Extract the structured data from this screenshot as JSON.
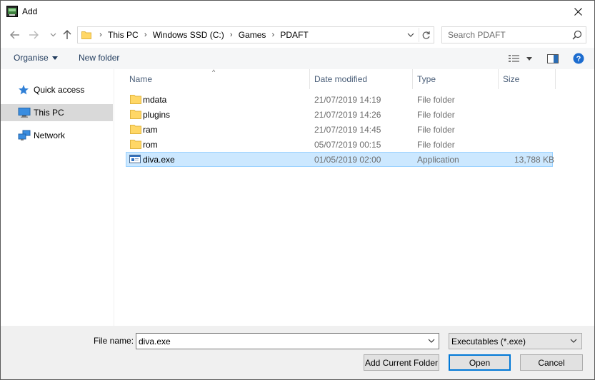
{
  "window": {
    "title": "Add",
    "colors": {
      "accent": "#0078d7",
      "selected_row": "#cce8ff",
      "toolbar_bg": "#f5f6f7",
      "footer_bg": "#f0f0f0"
    }
  },
  "address_bar": {
    "breadcrumbs": [
      "This PC",
      "Windows SSD (C:)",
      "Games",
      "PDAFT"
    ]
  },
  "search": {
    "placeholder": "Search PDAFT"
  },
  "toolbar": {
    "organise_label": "Organise",
    "new_folder_label": "New folder"
  },
  "sidebar": {
    "items": [
      {
        "label": "Quick access",
        "icon": "star-icon"
      },
      {
        "label": "This PC",
        "icon": "computer-icon",
        "selected": true
      },
      {
        "label": "Network",
        "icon": "network-icon"
      }
    ]
  },
  "file_list": {
    "columns": {
      "name": "Name",
      "date": "Date modified",
      "type": "Type",
      "size": "Size"
    },
    "rows": [
      {
        "name": "mdata",
        "date": "21/07/2019 14:19",
        "type": "File folder",
        "size": "",
        "icon": "folder-icon"
      },
      {
        "name": "plugins",
        "date": "21/07/2019 14:26",
        "type": "File folder",
        "size": "",
        "icon": "folder-icon"
      },
      {
        "name": "ram",
        "date": "21/07/2019 14:45",
        "type": "File folder",
        "size": "",
        "icon": "folder-icon"
      },
      {
        "name": "rom",
        "date": "05/07/2019 00:15",
        "type": "File folder",
        "size": "",
        "icon": "folder-icon"
      },
      {
        "name": "diva.exe",
        "date": "01/05/2019 02:00",
        "type": "Application",
        "size": "13,788 KB",
        "icon": "application-icon",
        "selected": true
      }
    ]
  },
  "footer": {
    "file_name_label": "File name:",
    "file_name_value": "diva.exe",
    "file_type_value": "Executables (*.exe)",
    "add_current_folder_label": "Add Current Folder",
    "open_label": "Open",
    "cancel_label": "Cancel"
  }
}
